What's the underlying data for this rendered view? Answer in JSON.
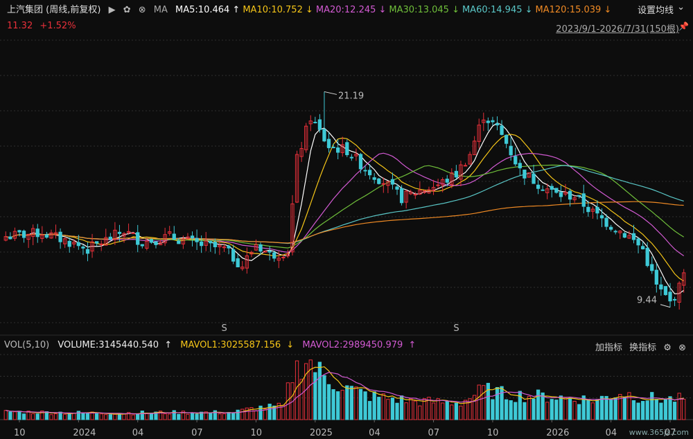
{
  "header": {
    "title": "上汽集团 (周线,前复权)",
    "ma_label": "MA",
    "ma_items": [
      {
        "label": "MA5:10.464",
        "arrow": "↑",
        "color": "#ffffff"
      },
      {
        "label": "MA10:10.752",
        "arrow": "↓",
        "color": "#f5c518"
      },
      {
        "label": "MA20:12.245",
        "arrow": "↓",
        "color": "#d25ad2"
      },
      {
        "label": "MA30:13.045",
        "arrow": "↓",
        "color": "#6fbf3a"
      },
      {
        "label": "MA60:14.945",
        "arrow": "↓",
        "color": "#5ac8c8"
      },
      {
        "label": "MA120:15.039",
        "arrow": "↓",
        "color": "#f08a24"
      }
    ],
    "settings_label": "设置均线",
    "price": "11.32",
    "change": "+1.52%",
    "range": "2023/9/1-2026/7/31(150根)"
  },
  "volume_header": {
    "title": "VOL(5,10)",
    "volume": "VOLUME:3145440.540",
    "volume_arrow": "↑",
    "mavol1": "MAVOL1:3025587.156",
    "mavol1_arrow": "↓",
    "mavol2": "MAVOL2:2989450.979",
    "mavol2_arrow": "↑",
    "add_indicator": "加指标",
    "switch_indicator": "换指标"
  },
  "watermark": "www.365jz.com",
  "colors": {
    "up": "#e8303a",
    "down": "#3ec9d6",
    "background": "#0d0d0d",
    "grid": "#3a3a3a"
  },
  "chart_data": {
    "type": "candlestick",
    "price_range": [
      8.6,
      24.0
    ],
    "annotations": [
      {
        "label": "21.19",
        "value": 21.19
      },
      {
        "label": "9.44",
        "value": 9.44
      }
    ],
    "x_tick_labels": [
      "10",
      "2024",
      "04",
      "07",
      "10",
      "2025",
      "04",
      "07",
      "10",
      "2026",
      "04",
      "07"
    ],
    "dividend_markers": [
      "S",
      "S"
    ],
    "price_keypoints": [
      [
        0,
        13.3
      ],
      [
        8,
        13.5
      ],
      [
        14,
        13.0
      ],
      [
        18,
        12.6
      ],
      [
        22,
        13.1
      ],
      [
        26,
        13.6
      ],
      [
        30,
        13.0
      ],
      [
        36,
        13.3
      ],
      [
        42,
        12.9
      ],
      [
        48,
        12.6
      ],
      [
        52,
        11.7
      ],
      [
        55,
        12.9
      ],
      [
        58,
        12.3
      ],
      [
        62,
        12.5
      ],
      [
        64,
        17.5
      ],
      [
        67,
        19.8
      ],
      [
        71,
        18.2
      ],
      [
        75,
        18.0
      ],
      [
        79,
        17.0
      ],
      [
        83,
        16.3
      ],
      [
        87,
        15.4
      ],
      [
        91,
        15.8
      ],
      [
        95,
        16.1
      ],
      [
        99,
        16.7
      ],
      [
        102,
        17.8
      ],
      [
        105,
        19.9
      ],
      [
        108,
        19.2
      ],
      [
        110,
        18.4
      ],
      [
        113,
        16.9
      ],
      [
        117,
        16.2
      ],
      [
        121,
        15.6
      ],
      [
        125,
        15.5
      ],
      [
        129,
        14.6
      ],
      [
        133,
        13.9
      ],
      [
        137,
        13.3
      ],
      [
        140,
        12.6
      ],
      [
        143,
        10.6
      ],
      [
        146,
        9.7
      ],
      [
        148,
        10.5
      ],
      [
        149,
        11.32
      ]
    ],
    "volume_keypoints_millions": [
      [
        0,
        1.2
      ],
      [
        20,
        1.0
      ],
      [
        40,
        1.1
      ],
      [
        50,
        1.1
      ],
      [
        55,
        1.8
      ],
      [
        61,
        2.0
      ],
      [
        63,
        7.0
      ],
      [
        66,
        9.5
      ],
      [
        70,
        6.5
      ],
      [
        75,
        4.8
      ],
      [
        80,
        3.6
      ],
      [
        90,
        2.8
      ],
      [
        100,
        2.6
      ],
      [
        105,
        4.6
      ],
      [
        110,
        3.8
      ],
      [
        120,
        3.5
      ],
      [
        130,
        3.0
      ],
      [
        135,
        4.2
      ],
      [
        140,
        3.4
      ],
      [
        145,
        3.1
      ],
      [
        149,
        3.15
      ]
    ],
    "ma_periods": [
      5,
      10,
      20,
      30,
      60,
      120
    ],
    "volume_ma_periods": [
      5,
      10
    ],
    "volume_ma_colors": [
      "#f5c518",
      "#d25ad2"
    ],
    "bars": 150
  }
}
